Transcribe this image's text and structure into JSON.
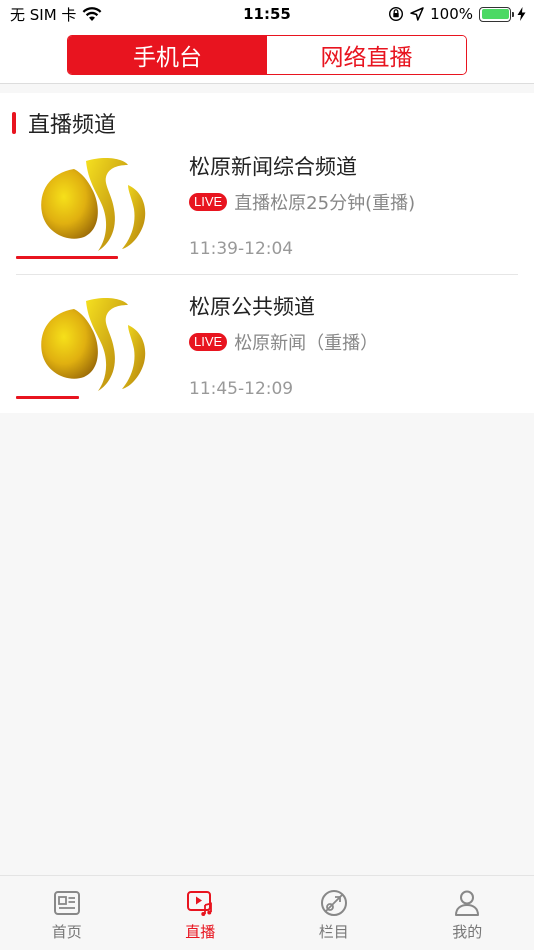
{
  "status_bar": {
    "carrier": "无 SIM 卡",
    "time": "11:55",
    "battery_percent": "100%",
    "battery_level": 1.0
  },
  "segmented": {
    "options": [
      {
        "label": "手机台",
        "selected": true
      },
      {
        "label": "网络直播",
        "selected": false
      }
    ]
  },
  "section": {
    "title": "直播频道"
  },
  "channels": [
    {
      "name": "松原新闻综合频道",
      "badge": "LIVE",
      "program": "直播松原25分钟(重播)",
      "time": "11:39-12:04",
      "progress": 0.68
    },
    {
      "name": "松原公共频道",
      "badge": "LIVE",
      "program": "松原新闻（重播）",
      "time": "11:45-12:09",
      "progress": 0.42
    }
  ],
  "tabbar": {
    "items": [
      {
        "label": "首页",
        "icon": "news-icon",
        "active": false
      },
      {
        "label": "直播",
        "icon": "live-video-icon",
        "active": true
      },
      {
        "label": "栏目",
        "icon": "column-disc-icon",
        "active": false
      },
      {
        "label": "我的",
        "icon": "person-icon",
        "active": false
      }
    ]
  },
  "colors": {
    "accent": "#e8141f",
    "battery": "#4cd964"
  }
}
